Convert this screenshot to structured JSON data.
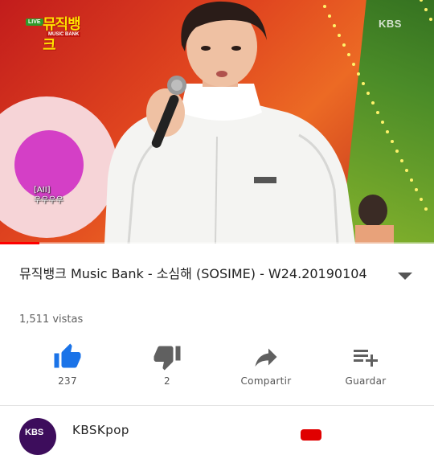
{
  "player": {
    "live_badge": "LIVE",
    "show_logo": "뮤직뱅크",
    "show_logo_sub": "MUSIC BANK",
    "broadcaster": "KBS",
    "subtitle_line1": "[AII]",
    "subtitle_line2": "우우우우",
    "progress": 0.09
  },
  "video": {
    "title": "뮤직뱅크 Music Bank - 소심해 (SOSIME) - W24.20190104",
    "views": "1,511 vistas"
  },
  "actions": {
    "like": {
      "label": "237",
      "icon": "thumbs-up-icon"
    },
    "dislike": {
      "label": "2",
      "icon": "thumbs-down-icon"
    },
    "share": {
      "label": "Compartir",
      "icon": "share-arrow-icon"
    },
    "save": {
      "label": "Guardar",
      "icon": "playlist-add-icon"
    }
  },
  "channel": {
    "avatar_text": "KBS",
    "name": "KBSKpop"
  },
  "colors": {
    "accent_blue": "#1a73e8",
    "brand_red": "#ff0000",
    "icon_grey": "#606060"
  }
}
